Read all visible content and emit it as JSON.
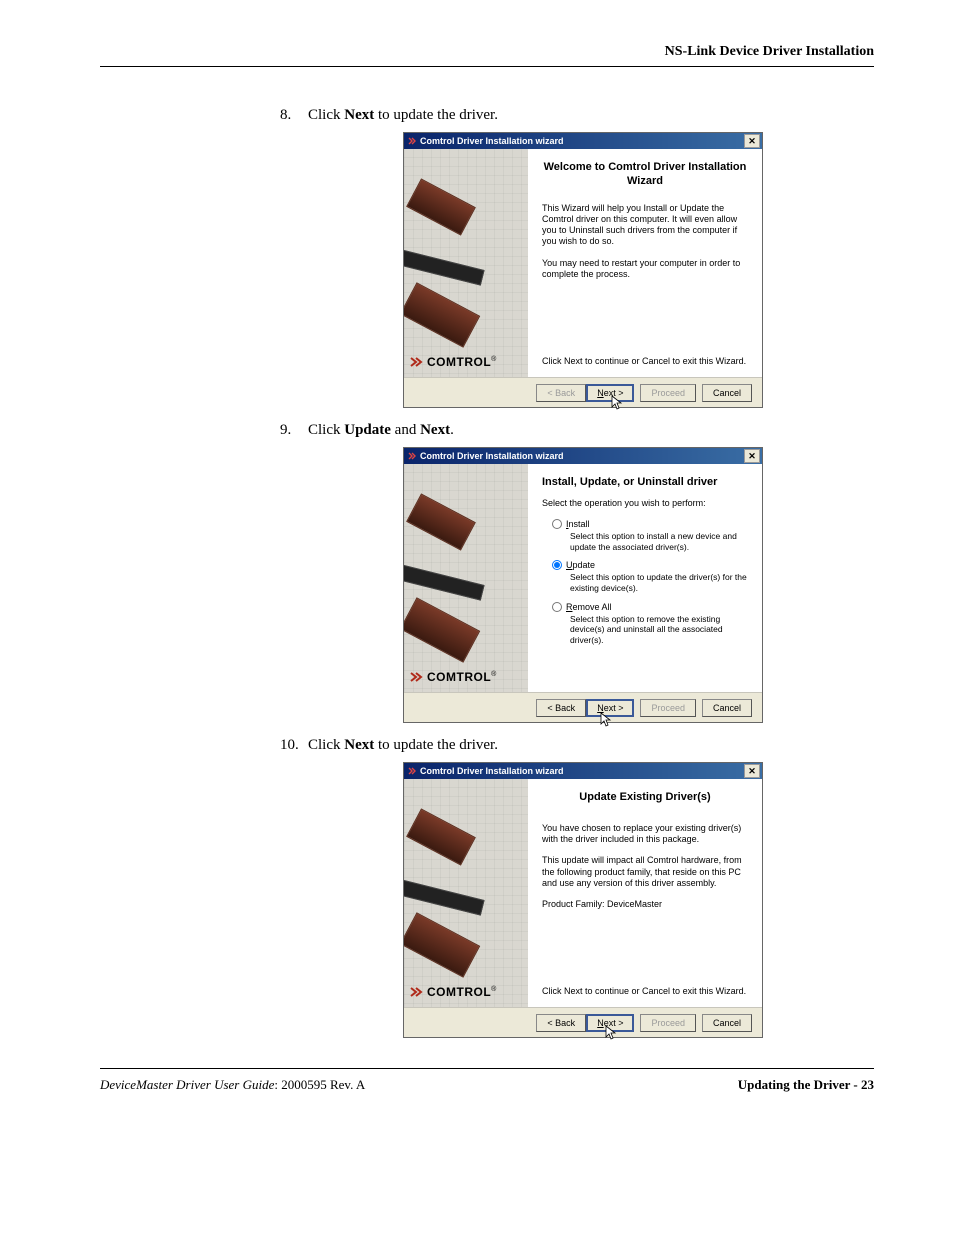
{
  "header": "NS-Link Device Driver Installation",
  "steps": [
    {
      "number": "8.",
      "prefix": "Click ",
      "bold1": "Next",
      "suffix": " to update the driver."
    },
    {
      "number": "9.",
      "prefix": "Click ",
      "bold1": "Update",
      "middle": " and ",
      "bold2": "Next",
      "suffix": "."
    },
    {
      "number": "10.",
      "prefix": "Click ",
      "bold1": "Next",
      "suffix": " to update the driver."
    }
  ],
  "wizard_title": "Comtrol Driver Installation wizard",
  "logo_text": "COMTROL",
  "logo_r": "®",
  "buttons": {
    "back": "< Back",
    "next_u": "N",
    "next_rest": "ext >",
    "proceed": "Proceed",
    "cancel": "Cancel"
  },
  "dlg1": {
    "heading": "Welcome to Comtrol Driver Installation Wizard",
    "p1": "This Wizard will help you Install or Update the Comtrol driver on this computer. It will even allow you to Uninstall such drivers from the computer if you wish to do so.",
    "p2": "You may need to restart your computer in order to complete the process.",
    "tail": "Click Next to continue or Cancel to exit this Wizard."
  },
  "dlg2": {
    "heading": "Install, Update, or Uninstall driver",
    "intro": "Select the operation you wish to perform:",
    "options": [
      {
        "label_u": "I",
        "label_rest": "nstall",
        "desc": "Select this option to install a new device and update the associated driver(s)."
      },
      {
        "label_u": "U",
        "label_rest": "pdate",
        "desc": "Select this option to update the driver(s) for the existing device(s)."
      },
      {
        "label_u": "R",
        "label_rest": "emove All",
        "desc": "Select this option to remove the existing device(s) and uninstall all the associated driver(s)."
      }
    ],
    "selected_index": 1
  },
  "dlg3": {
    "heading": "Update Existing Driver(s)",
    "p1": "You have chosen to replace your existing driver(s) with the driver included in this package.",
    "p2": "This update will impact all Comtrol hardware, from the following product family, that reside on this PC and use any version of this driver assembly.",
    "family": "Product Family:  DeviceMaster",
    "tail": "Click Next to continue or Cancel to exit this Wizard."
  },
  "footer": {
    "left_italic": "DeviceMaster Driver User Guide",
    "left_rest": ": 2000595 Rev. A",
    "right": "Updating the Driver - 23"
  }
}
